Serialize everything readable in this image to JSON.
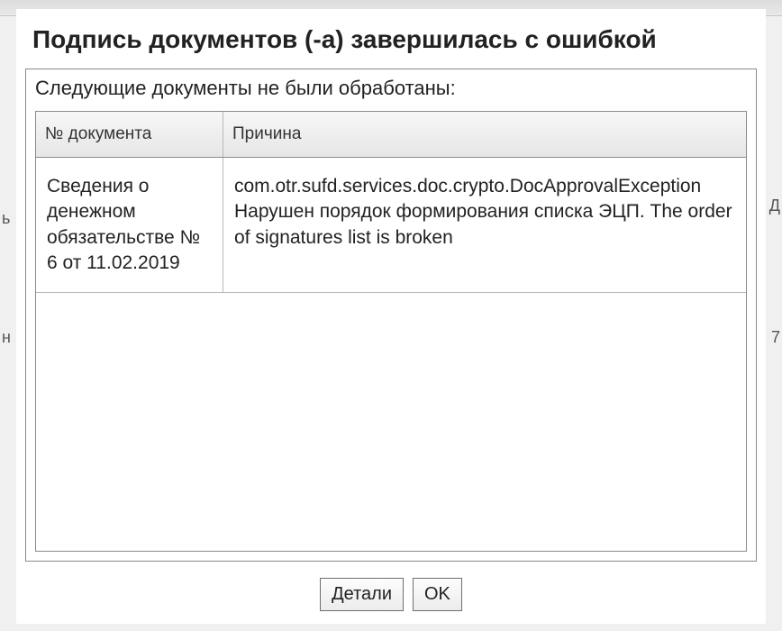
{
  "dialog": {
    "title": "Подпись документов (-а) завершилась с ошибкой",
    "message": "Следующие документы не были обработаны:"
  },
  "table": {
    "headers": {
      "document": "№ документа",
      "reason": "Причина"
    },
    "rows": [
      {
        "document": "Сведения о денежном обязательстве № 6 от 11.02.2019",
        "reason": "com.otr.sufd.services.doc.crypto.DocApprovalException Нарушен порядок формирования списка ЭЦП. The order of signatures list is broken"
      }
    ]
  },
  "buttons": {
    "details": "Детали",
    "ok": "OK"
  },
  "backdrop": {
    "frag_left1": "ь",
    "frag_left2": "н",
    "frag_right1": "Д",
    "frag_right2": "7"
  }
}
